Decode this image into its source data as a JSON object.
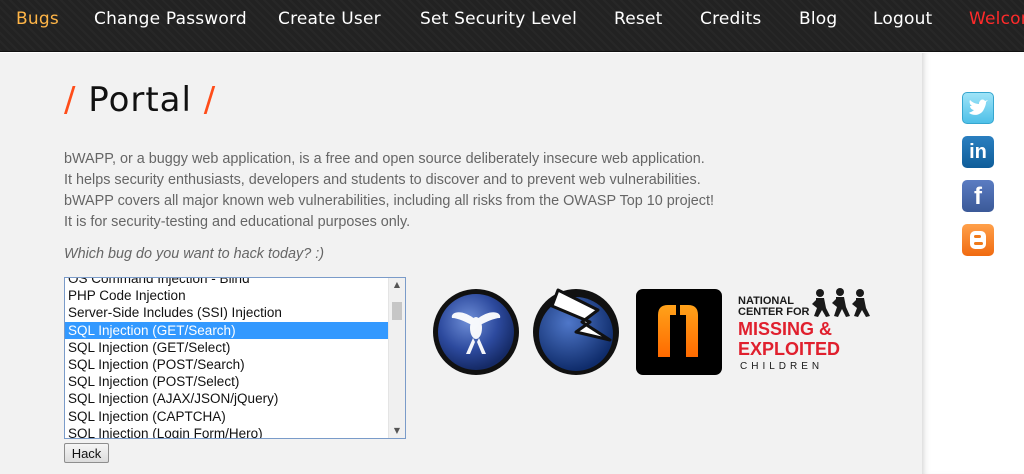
{
  "nav": {
    "items": [
      {
        "label": "Bugs"
      },
      {
        "label": "Change Password"
      },
      {
        "label": "Create User"
      },
      {
        "label": "Set Security Level"
      },
      {
        "label": "Reset"
      },
      {
        "label": "Credits"
      },
      {
        "label": "Blog"
      },
      {
        "label": "Logout"
      }
    ],
    "welcome": "Welcome"
  },
  "page": {
    "title": "Portal",
    "title_slash_left": "/",
    "title_slash_right": "/",
    "intro": [
      "bWAPP, or a buggy web application, is a free and open source deliberately insecure web application.",
      "It helps security enthusiasts, developers and students to discover and to prevent web vulnerabilities.",
      "bWAPP covers all major known web vulnerabilities, including all risks from the OWASP Top 10 project!",
      "It is for security-testing and educational purposes only."
    ],
    "question": "Which bug do you want to hack today? :)"
  },
  "bug_list": {
    "options": [
      "OS Command Injection - Blind",
      "PHP Code Injection",
      "Server-Side Includes (SSI) Injection",
      "SQL Injection (GET/Search)",
      "SQL Injection (GET/Select)",
      "SQL Injection (POST/Search)",
      "SQL Injection (POST/Select)",
      "SQL Injection (AJAX/JSON/jQuery)",
      "SQL Injection (CAPTCHA)",
      "SQL Injection (Login Form/Hero)"
    ],
    "selected_index": 3,
    "hack_label": "Hack"
  },
  "logos": {
    "ncmec_line1": "NATIONAL",
    "ncmec_line2": "CENTER FOR",
    "ncmec_line3": "MISSING &",
    "ncmec_line4": "EXPLOITED",
    "ncmec_line5": "CHILDREN"
  },
  "social": {
    "linkedin_glyph": "in",
    "facebook_glyph": "f"
  },
  "colors": {
    "accent_orange": "#ff4d1a",
    "nav_bugs": "#ffb547",
    "nav_welcome": "#ff2a2a",
    "selection_blue": "#3399ff",
    "ncmec_red": "#e0202e"
  }
}
